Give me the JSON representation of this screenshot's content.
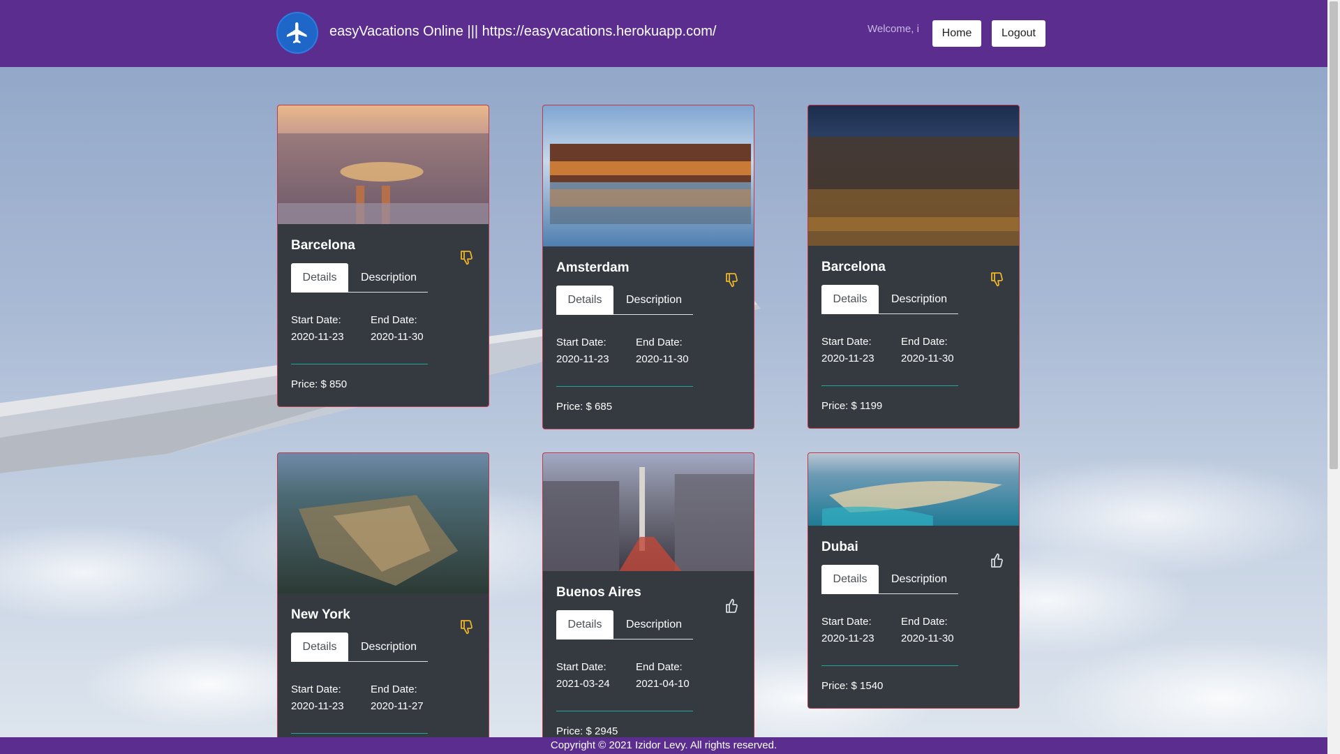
{
  "header": {
    "title": "easyVacations Online ||| https://easyvacations.herokuapp.com/",
    "welcome": "Welcome, i",
    "home_label": "Home",
    "logout_label": "Logout",
    "logo_icon": "airplane-icon"
  },
  "colors": {
    "header_bg": "#5a2d8f",
    "card_bg": "#343a40",
    "card_border": "#c0384a",
    "divider": "#1fa89a",
    "thumb_icon": "#f0b429"
  },
  "labels": {
    "details": "Details",
    "description": "Description",
    "start_date": "Start Date:",
    "end_date": "End Date:"
  },
  "cards": [
    {
      "name": "Barcelona",
      "start": "2020-11-23",
      "end": "2020-11-30",
      "price": "Price: $ 850",
      "like": "thumbs-down-icon"
    },
    {
      "name": "Amsterdam",
      "start": "2020-11-23",
      "end": "2020-11-30",
      "price": "Price: $ 685",
      "like": "thumbs-down-icon"
    },
    {
      "name": "Barcelona",
      "start": "2020-11-23",
      "end": "2020-11-30",
      "price": "Price: $ 1199",
      "like": "thumbs-down-icon"
    },
    {
      "name": "New York",
      "start": "2020-11-23",
      "end": "2020-11-27",
      "price": "",
      "like": "thumbs-down-icon"
    },
    {
      "name": "Buenos Aires",
      "start": "2021-03-24",
      "end": "2021-04-10",
      "price": "Price: $ 2945",
      "like": "thumbs-up-icon"
    },
    {
      "name": "Dubai",
      "start": "2020-11-23",
      "end": "2020-11-30",
      "price": "Price: $ 1540",
      "like": "thumbs-up-icon"
    }
  ],
  "footer": {
    "text": "Copyright © 2021 Izidor Levy. All rights reserved."
  }
}
